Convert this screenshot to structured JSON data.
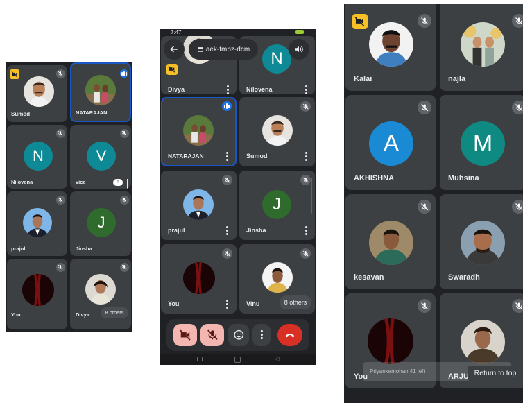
{
  "left": {
    "tiles": [
      {
        "name": "Sumod"
      },
      {
        "name": "NATARAJAN"
      },
      {
        "name": "Nilovena",
        "initial": "N"
      },
      {
        "name": "vice",
        "initial": "V"
      },
      {
        "name": "prajul"
      },
      {
        "name": "Jinsha",
        "initial": "J"
      },
      {
        "name": "You"
      },
      {
        "name": "Divya"
      }
    ],
    "others_label": "8 others",
    "float_label": "↑"
  },
  "middle": {
    "status_time": "7:47",
    "meeting_code": "aek-tmbz-dcm",
    "tiles": [
      {
        "name": "Divya"
      },
      {
        "name": "Nilovena",
        "initial": "N"
      },
      {
        "name": "NATARAJAN"
      },
      {
        "name": "Sumod"
      },
      {
        "name": "prajul"
      },
      {
        "name": "Jinsha",
        "initial": "J"
      },
      {
        "name": "You"
      },
      {
        "name": "Vinu"
      }
    ],
    "others_label": "8 others"
  },
  "right": {
    "tiles": [
      {
        "name": "Kalai"
      },
      {
        "name": "najla"
      },
      {
        "name": "AKHISHNA",
        "initial": "A"
      },
      {
        "name": "Muhsina",
        "initial": "M"
      },
      {
        "name": "kesavan"
      },
      {
        "name": "Swaradh"
      },
      {
        "name": "You"
      },
      {
        "name": "ARJUN"
      }
    ],
    "toast": "Priyankamohan 41 left",
    "return_label": "Return to top"
  },
  "colors": {
    "teal": "#0e8a96",
    "green": "#2e6b2d",
    "blue": "#1a8ad4",
    "end_call": "#d93025",
    "muted_ctrl": "#f4b6b0"
  }
}
